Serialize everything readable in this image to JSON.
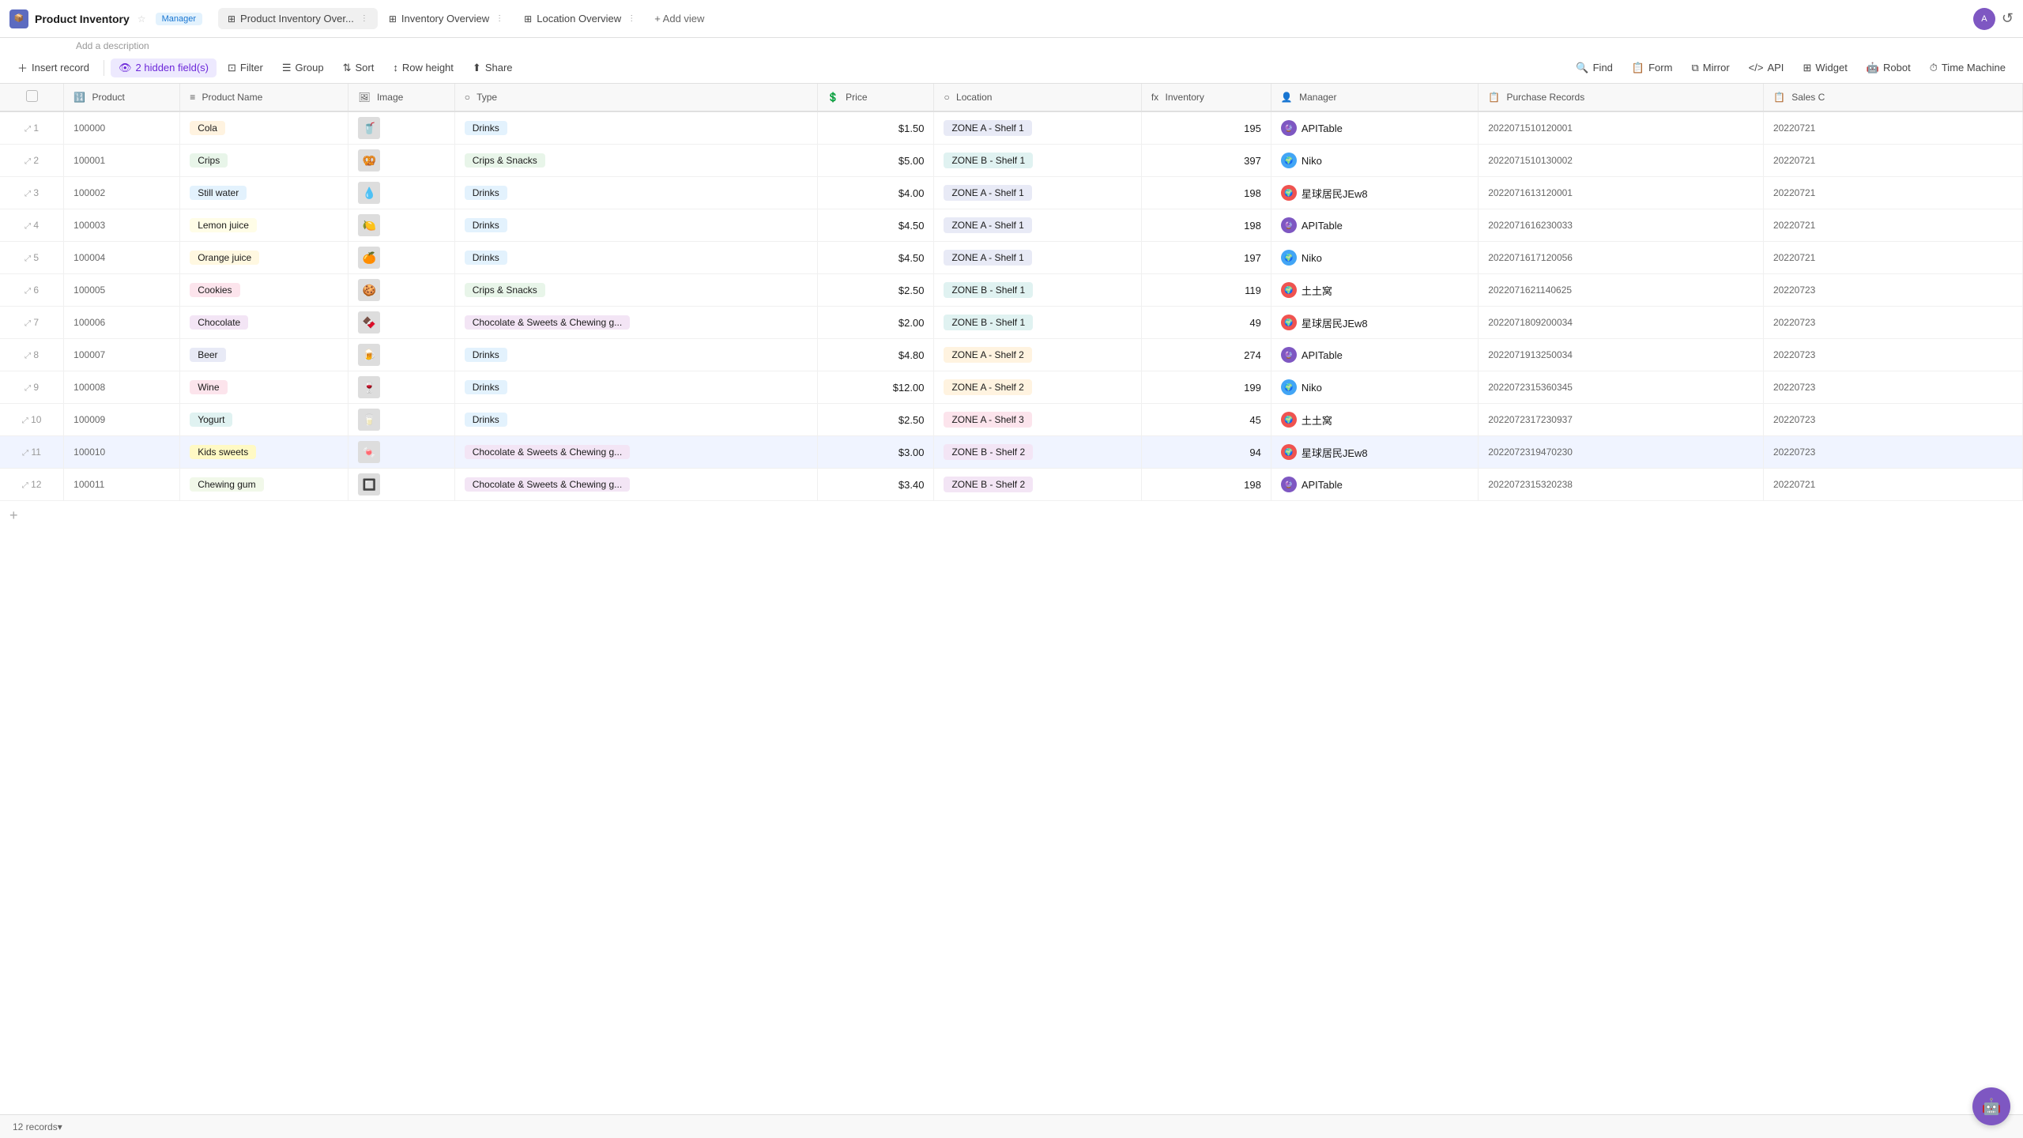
{
  "app": {
    "icon": "📦",
    "title": "Product Inventory",
    "star": "☆",
    "manager_badge": "Manager",
    "description": "Add a description"
  },
  "tabs": [
    {
      "id": "product-inventory",
      "icon": "⊞",
      "label": "Product Inventory Over...",
      "active": true
    },
    {
      "id": "inventory-overview",
      "icon": "⊞",
      "label": "Inventory Overview",
      "active": false
    },
    {
      "id": "location-overview",
      "icon": "⊞",
      "label": "Location Overview",
      "active": false
    }
  ],
  "add_view": "+ Add view",
  "toolbar": {
    "insert_record": "Insert record",
    "hidden_fields": "2 hidden field(s)",
    "filter": "Filter",
    "group": "Group",
    "sort": "Sort",
    "row_height": "Row height",
    "share": "Share",
    "find": "Find",
    "form": "Form",
    "mirror": "Mirror",
    "api": "API",
    "widget": "Widget",
    "robot": "Robot",
    "time_machine": "Time Machine"
  },
  "columns": [
    {
      "id": "product",
      "label": "Product",
      "icon": "🔢"
    },
    {
      "id": "name",
      "label": "Product Name",
      "icon": "≡"
    },
    {
      "id": "image",
      "label": "Image",
      "icon": "🖼"
    },
    {
      "id": "type",
      "label": "Type",
      "icon": "○"
    },
    {
      "id": "price",
      "label": "Price",
      "icon": "💲"
    },
    {
      "id": "location",
      "label": "Location",
      "icon": "○"
    },
    {
      "id": "inventory",
      "label": "Inventory",
      "icon": "fx"
    },
    {
      "id": "manager",
      "label": "Manager",
      "icon": "👤"
    },
    {
      "id": "purchase",
      "label": "Purchase Records",
      "icon": "📋"
    },
    {
      "id": "sales",
      "label": "Sales C",
      "icon": "📋"
    }
  ],
  "rows": [
    {
      "row_num": 1,
      "product_id": "100000",
      "name": "Cola",
      "name_color": "tag-cola",
      "image": "🥤",
      "type": "Drinks",
      "type_color": "type-drinks",
      "price": "$1.50",
      "location": "ZONE A - Shelf 1",
      "location_color": "loc-za1",
      "inventory": 195,
      "manager": "APITable",
      "manager_avatar": "av-apitable",
      "manager_icon": "🔮",
      "purchase": "2022071510120001",
      "sales": "20220721"
    },
    {
      "row_num": 2,
      "product_id": "100001",
      "name": "Crips",
      "name_color": "tag-crips",
      "image": "🥨",
      "type": "Crips & Snacks",
      "type_color": "type-crips",
      "price": "$5.00",
      "location": "ZONE B - Shelf 1",
      "location_color": "loc-zb1",
      "inventory": 397,
      "manager": "Niko",
      "manager_avatar": "av-niko",
      "manager_icon": "🌍",
      "purchase": "2022071510130002",
      "sales": "20220721"
    },
    {
      "row_num": 3,
      "product_id": "100002",
      "name": "Still water",
      "name_color": "tag-stillwater",
      "image": "💧",
      "type": "Drinks",
      "type_color": "type-drinks",
      "price": "$4.00",
      "location": "ZONE A - Shelf 1",
      "location_color": "loc-za1",
      "inventory": 198,
      "manager": "星球居民JEw8",
      "manager_avatar": "av-star",
      "manager_icon": "🌍",
      "purchase": "2022071613120001",
      "sales": "20220721"
    },
    {
      "row_num": 4,
      "product_id": "100003",
      "name": "Lemon juice",
      "name_color": "tag-lemon",
      "image": "🍋",
      "type": "Drinks",
      "type_color": "type-drinks",
      "price": "$4.50",
      "location": "ZONE A - Shelf 1",
      "location_color": "loc-za1",
      "inventory": 198,
      "manager": "APITable",
      "manager_avatar": "av-apitable",
      "manager_icon": "🔮",
      "purchase": "2022071616230033",
      "sales": "20220721"
    },
    {
      "row_num": 5,
      "product_id": "100004",
      "name": "Orange juice",
      "name_color": "tag-orange",
      "image": "🍊",
      "type": "Drinks",
      "type_color": "type-drinks",
      "price": "$4.50",
      "location": "ZONE A - Shelf 1",
      "location_color": "loc-za1",
      "inventory": 197,
      "manager": "Niko",
      "manager_avatar": "av-niko",
      "manager_icon": "🌍",
      "purchase": "2022071617120056",
      "sales": "20220721"
    },
    {
      "row_num": 6,
      "product_id": "100005",
      "name": "Cookies",
      "name_color": "tag-cookies",
      "image": "🍪",
      "type": "Crips & Snacks",
      "type_color": "type-crips",
      "price": "$2.50",
      "location": "ZONE B - Shelf 1",
      "location_color": "loc-zb1",
      "inventory": 119,
      "manager": "土土窝",
      "manager_avatar": "av-star",
      "manager_icon": "🌍",
      "purchase": "2022071621140625",
      "sales": "20220723"
    },
    {
      "row_num": 7,
      "product_id": "100006",
      "name": "Chocolate",
      "name_color": "tag-chocolate",
      "image": "🍫",
      "type": "Chocolate & Sweets & Chewing g...",
      "type_color": "type-choc",
      "price": "$2.00",
      "location": "ZONE B - Shelf 1",
      "location_color": "loc-zb1",
      "inventory": 49,
      "manager": "星球居民JEw8",
      "manager_avatar": "av-star",
      "manager_icon": "🌍",
      "purchase": "2022071809200034",
      "sales": "20220723"
    },
    {
      "row_num": 8,
      "product_id": "100007",
      "name": "Beer",
      "name_color": "tag-beer",
      "image": "🍺",
      "type": "Drinks",
      "type_color": "type-drinks",
      "price": "$4.80",
      "location": "ZONE A - Shelf 2",
      "location_color": "loc-za2",
      "inventory": 274,
      "manager": "APITable",
      "manager_avatar": "av-apitable",
      "manager_icon": "🔮",
      "purchase": "2022071913250034",
      "sales": "20220723"
    },
    {
      "row_num": 9,
      "product_id": "100008",
      "name": "Wine",
      "name_color": "tag-wine",
      "image": "🍷",
      "type": "Drinks",
      "type_color": "type-drinks",
      "price": "$12.00",
      "location": "ZONE A - Shelf 2",
      "location_color": "loc-za2",
      "inventory": 199,
      "manager": "Niko",
      "manager_avatar": "av-niko",
      "manager_icon": "🌍",
      "purchase": "2022072315360345",
      "sales": "20220723"
    },
    {
      "row_num": 10,
      "product_id": "100009",
      "name": "Yogurt",
      "name_color": "tag-yogurt",
      "image": "🥛",
      "type": "Drinks",
      "type_color": "type-drinks",
      "price": "$2.50",
      "location": "ZONE A - Shelf 3",
      "location_color": "loc-za3",
      "inventory": 45,
      "manager": "土土窝",
      "manager_avatar": "av-star",
      "manager_icon": "🌍",
      "purchase": "2022072317230937",
      "sales": "20220723"
    },
    {
      "row_num": 11,
      "product_id": "100010",
      "name": "Kids sweets",
      "name_color": "tag-kids",
      "image": "🍬",
      "type": "Chocolate & Sweets & Chewing g...",
      "type_color": "type-choc",
      "price": "$3.00",
      "location": "ZONE B - Shelf 2",
      "location_color": "loc-zb2",
      "inventory": 94,
      "manager": "星球居民JEw8",
      "manager_avatar": "av-star",
      "manager_icon": "🌍",
      "purchase": "2022072319470230",
      "sales": "20220723",
      "selected": true
    },
    {
      "row_num": 12,
      "product_id": "100011",
      "name": "Chewing gum",
      "name_color": "tag-chewing",
      "image": "🔲",
      "type": "Chocolate & Sweets & Chewing g...",
      "type_color": "type-choc",
      "price": "$3.40",
      "location": "ZONE B - Shelf 2",
      "location_color": "loc-zb2",
      "inventory": 198,
      "manager": "APITable",
      "manager_avatar": "av-apitable",
      "manager_icon": "🔮",
      "purchase": "2022072315320238",
      "sales": "20220721"
    }
  ],
  "footer": {
    "records_count": "12 records",
    "records_icon": "▾"
  }
}
